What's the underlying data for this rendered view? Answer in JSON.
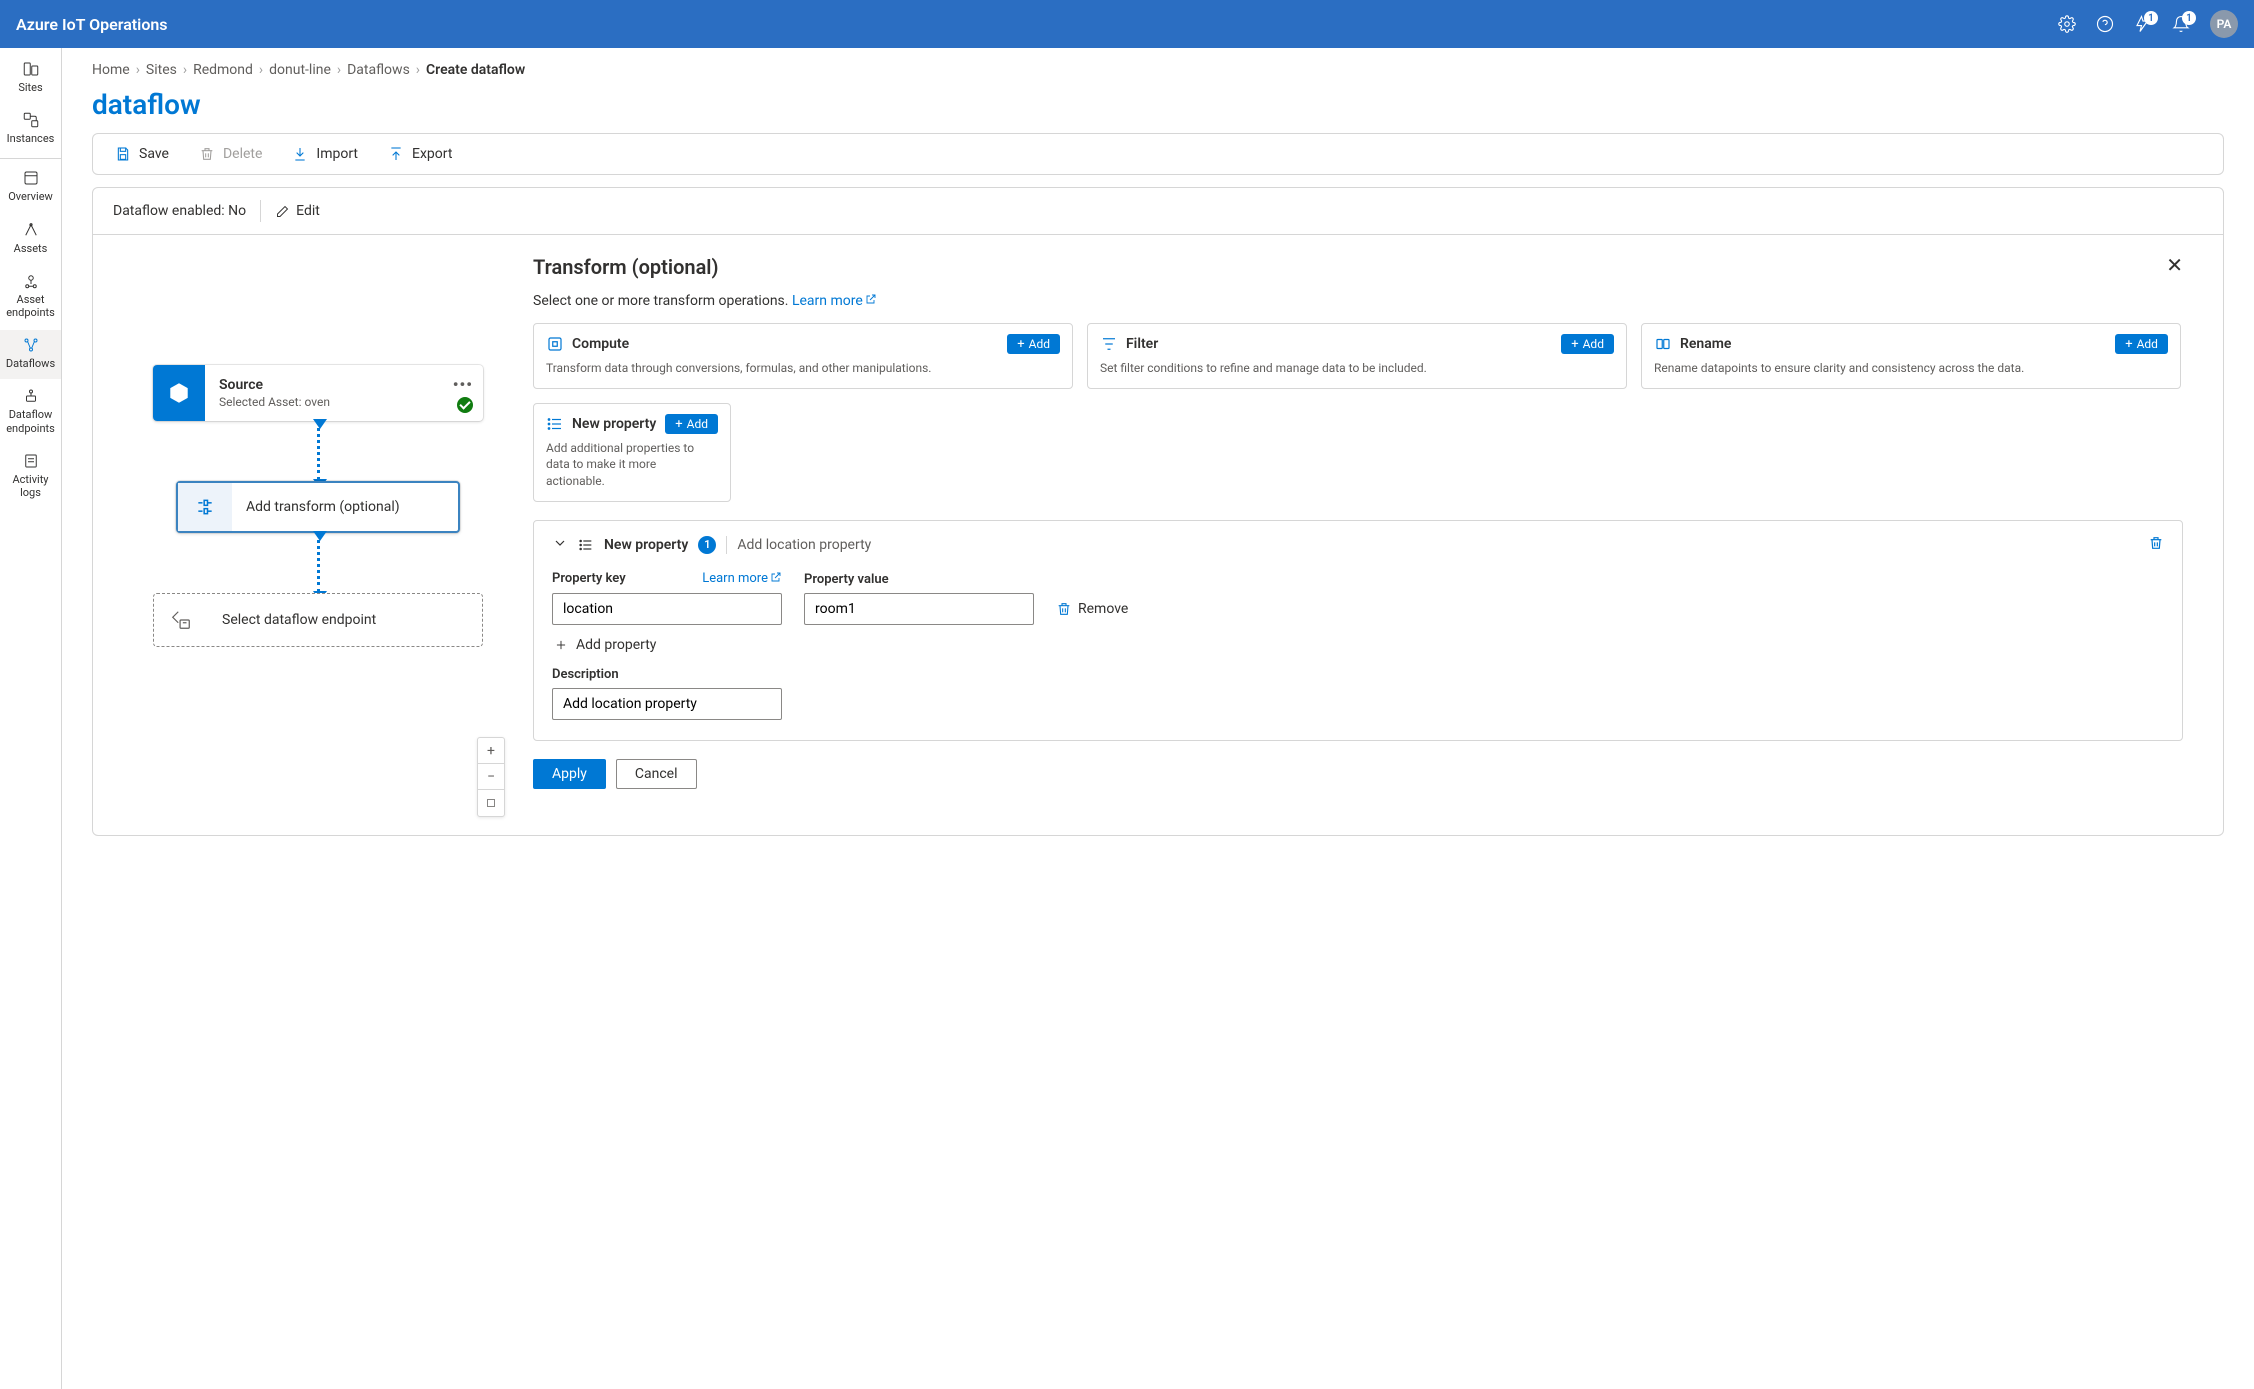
{
  "header": {
    "title": "Azure IoT Operations",
    "notifications_badge": "1",
    "alerts_badge": "1",
    "avatar": "PA"
  },
  "nav": {
    "sites": "Sites",
    "instances": "Instances",
    "overview": "Overview",
    "assets": "Assets",
    "asset_endpoints": "Asset endpoints",
    "dataflows": "Dataflows",
    "dataflow_endpoints": "Dataflow endpoints",
    "activity_logs": "Activity logs"
  },
  "breadcrumb": [
    "Home",
    "Sites",
    "Redmond",
    "donut-line",
    "Dataflows",
    "Create dataflow"
  ],
  "page_title": "dataflow",
  "toolbar": {
    "save": "Save",
    "delete": "Delete",
    "import": "Import",
    "export": "Export"
  },
  "status": {
    "label": "Dataflow enabled: No",
    "edit": "Edit"
  },
  "nodes": {
    "source_title": "Source",
    "source_sub": "Selected Asset: oven",
    "transform_title": "Add transform (optional)",
    "endpoint_title": "Select dataflow endpoint"
  },
  "rightpane": {
    "title": "Transform (optional)",
    "subtitle": "Select one or more transform operations.",
    "learn_more": "Learn more",
    "ops": {
      "compute": {
        "title": "Compute",
        "desc": "Transform data through conversions, formulas, and other manipulations."
      },
      "filter": {
        "title": "Filter",
        "desc": "Set filter conditions to refine and manage data to be included."
      },
      "rename": {
        "title": "Rename",
        "desc": "Rename datapoints to ensure clarity and consistency across the data."
      },
      "newprop": {
        "title": "New property",
        "desc": "Add additional properties to data to make it more actionable."
      }
    },
    "add": "Add",
    "editor": {
      "badge_label": "New property",
      "count": "1",
      "summary": "Add location property",
      "key_label": "Property key",
      "value_label": "Property value",
      "key_value": "location",
      "value_value": "room1",
      "remove": "Remove",
      "add_property": "Add property",
      "description_label": "Description",
      "description_value": "Add location property"
    },
    "apply": "Apply",
    "cancel": "Cancel"
  }
}
